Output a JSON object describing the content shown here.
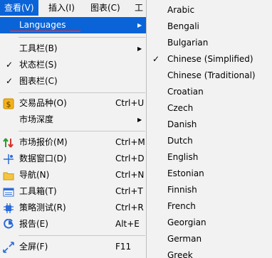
{
  "menubar": {
    "items": [
      "查看(V)",
      "插入(I)",
      "图表(C)",
      "工"
    ]
  },
  "menu": {
    "languages": "Languages",
    "toolbar": "工具栏(B)",
    "statusbar": "状态栏(S)",
    "chartbar": "图表栏(C)",
    "symbols": {
      "label": "交易品种(O)",
      "shortcut": "Ctrl+U"
    },
    "depth": "市场深度",
    "market_watch": {
      "label": "市场报价(M)",
      "shortcut": "Ctrl+M"
    },
    "data_window": {
      "label": "数据窗口(D)",
      "shortcut": "Ctrl+D"
    },
    "navigator": {
      "label": "导航(N)",
      "shortcut": "Ctrl+N"
    },
    "toolbox": {
      "label": "工具箱(T)",
      "shortcut": "Ctrl+T"
    },
    "tester": {
      "label": "策略测试(R)",
      "shortcut": "Ctrl+R"
    },
    "reports": {
      "label": "报告(E)",
      "shortcut": "Alt+E"
    },
    "fullscreen": {
      "label": "全屏(F)",
      "shortcut": "F11"
    },
    "check_mark": "✓",
    "submenu_arrow": "▶"
  },
  "languages": {
    "items": [
      "Arabic",
      "Bengali",
      "Bulgarian",
      "Chinese (Simplified)",
      "Chinese (Traditional)",
      "Croatian",
      "Czech",
      "Danish",
      "Dutch",
      "English",
      "Estonian",
      "Finnish",
      "French",
      "Georgian",
      "German",
      "Greek"
    ],
    "selected": "Chinese (Simplified)"
  },
  "colors": {
    "highlight": "#0a64d8",
    "underline": "#e03030",
    "menu_bg": "#f2f2f2"
  }
}
